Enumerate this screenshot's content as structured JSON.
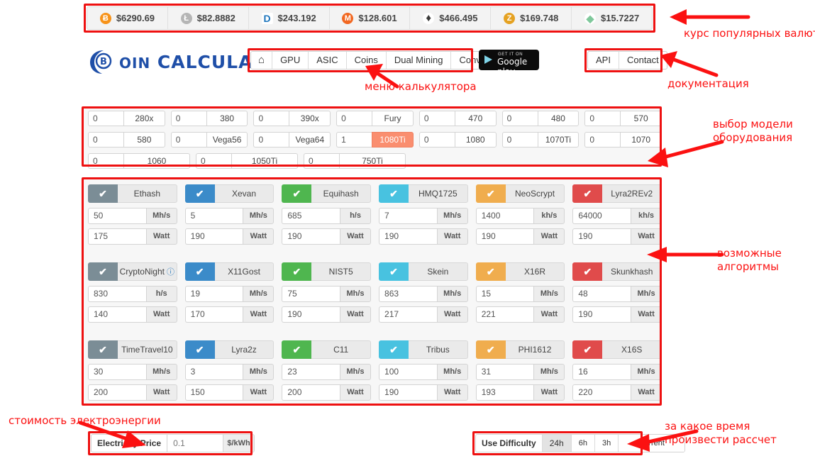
{
  "ticker": {
    "items": [
      {
        "icon": "bitcoin-icon",
        "symbol": "Ƀ",
        "price": "$6290.69"
      },
      {
        "icon": "litecoin-icon",
        "symbol": "Ł",
        "price": "$82.8882"
      },
      {
        "icon": "dash-icon",
        "symbol": "D",
        "price": "$243.192"
      },
      {
        "icon": "monero-icon",
        "symbol": "M",
        "price": "$128.601"
      },
      {
        "icon": "ethereum-icon",
        "symbol": "♦",
        "price": "$466.495"
      },
      {
        "icon": "zcash-icon",
        "symbol": "Z",
        "price": "$169.748"
      },
      {
        "icon": "zencash-icon",
        "symbol": "◆",
        "price": "$15.7227"
      }
    ]
  },
  "header": {
    "logo_primary": "OIN",
    "logo_secondary": "CALCULATORS",
    "main_menu": [
      {
        "name": "home",
        "label": "⌂"
      },
      {
        "name": "gpu",
        "label": "GPU"
      },
      {
        "name": "asic",
        "label": "ASIC"
      },
      {
        "name": "coins",
        "label": "Coins"
      },
      {
        "name": "dual-mining",
        "label": "Dual Mining"
      },
      {
        "name": "converter",
        "label": "Converter"
      }
    ],
    "google_play": {
      "line1": "GET IT ON",
      "line2": "Google play"
    },
    "doc_menu": [
      {
        "name": "api",
        "label": "API"
      },
      {
        "name": "contact",
        "label": "Contact"
      }
    ]
  },
  "gpu_grid": {
    "rows": [
      [
        {
          "qty": "0",
          "model": "280x",
          "selected": false
        },
        {
          "qty": "0",
          "model": "380",
          "selected": false
        },
        {
          "qty": "0",
          "model": "390x",
          "selected": false
        },
        {
          "qty": "0",
          "model": "Fury",
          "selected": false
        },
        {
          "qty": "0",
          "model": "470",
          "selected": false
        },
        {
          "qty": "0",
          "model": "480",
          "selected": false
        },
        {
          "qty": "0",
          "model": "570",
          "selected": false
        }
      ],
      [
        {
          "qty": "0",
          "model": "580",
          "selected": false
        },
        {
          "qty": "0",
          "model": "Vega56",
          "selected": false
        },
        {
          "qty": "0",
          "model": "Vega64",
          "selected": false
        },
        {
          "qty": "1",
          "model": "1080Ti",
          "selected": true
        },
        {
          "qty": "0",
          "model": "1080",
          "selected": false
        },
        {
          "qty": "0",
          "model": "1070Ti",
          "selected": false
        },
        {
          "qty": "0",
          "model": "1070",
          "selected": false
        }
      ],
      [
        {
          "qty": "0",
          "model": "1060",
          "selected": false
        },
        {
          "qty": "0",
          "model": "1050Ti",
          "selected": false
        },
        {
          "qty": "0",
          "model": "750Ti",
          "selected": false
        }
      ]
    ]
  },
  "algorithms": {
    "check_glyph": "✔",
    "help_glyph": "❓",
    "rows": [
      [
        {
          "name": "Ethash",
          "color_class": "c-gray",
          "color": "#7b8d96",
          "hashrate": "50",
          "hash_unit": "Mh/s",
          "power": "175",
          "power_unit": "Watt",
          "checked": true,
          "help": false
        },
        {
          "name": "Xevan",
          "color_class": "c-blue",
          "color": "#3b8bc9",
          "hashrate": "5",
          "hash_unit": "Mh/s",
          "power": "190",
          "power_unit": "Watt",
          "checked": true,
          "help": false
        },
        {
          "name": "Equihash",
          "color_class": "c-green",
          "color": "#4fb64f",
          "hashrate": "685",
          "hash_unit": "h/s",
          "power": "190",
          "power_unit": "Watt",
          "checked": true,
          "help": false
        },
        {
          "name": "HMQ1725",
          "color_class": "c-cyan",
          "color": "#48c2e0",
          "hashrate": "7",
          "hash_unit": "Mh/s",
          "power": "190",
          "power_unit": "Watt",
          "checked": true,
          "help": false
        },
        {
          "name": "NeoScrypt",
          "color_class": "c-orange",
          "color": "#f0ad4e",
          "hashrate": "1400",
          "hash_unit": "kh/s",
          "power": "190",
          "power_unit": "Watt",
          "checked": true,
          "help": false
        },
        {
          "name": "Lyra2REv2",
          "color_class": "c-red",
          "color": "#e04b4b",
          "hashrate": "64000",
          "hash_unit": "kh/s",
          "power": "190",
          "power_unit": "Watt",
          "checked": true,
          "help": false
        }
      ],
      [
        {
          "name": "CryptoNight",
          "color_class": "c-gray",
          "color": "#7b8d96",
          "hashrate": "830",
          "hash_unit": "h/s",
          "power": "140",
          "power_unit": "Watt",
          "checked": true,
          "help": true
        },
        {
          "name": "X11Gost",
          "color_class": "c-blue",
          "color": "#3b8bc9",
          "hashrate": "19",
          "hash_unit": "Mh/s",
          "power": "170",
          "power_unit": "Watt",
          "checked": true,
          "help": false
        },
        {
          "name": "NIST5",
          "color_class": "c-green",
          "color": "#4fb64f",
          "hashrate": "75",
          "hash_unit": "Mh/s",
          "power": "190",
          "power_unit": "Watt",
          "checked": true,
          "help": false
        },
        {
          "name": "Skein",
          "color_class": "c-cyan",
          "color": "#48c2e0",
          "hashrate": "863",
          "hash_unit": "Mh/s",
          "power": "217",
          "power_unit": "Watt",
          "checked": true,
          "help": false
        },
        {
          "name": "X16R",
          "color_class": "c-orange",
          "color": "#f0ad4e",
          "hashrate": "15",
          "hash_unit": "Mh/s",
          "power": "221",
          "power_unit": "Watt",
          "checked": true,
          "help": false
        },
        {
          "name": "Skunkhash",
          "color_class": "c-red",
          "color": "#e04b4b",
          "hashrate": "48",
          "hash_unit": "Mh/s",
          "power": "190",
          "power_unit": "Watt",
          "checked": true,
          "help": false
        }
      ],
      [
        {
          "name": "TimeTravel10",
          "color_class": "c-gray",
          "color": "#7b8d96",
          "hashrate": "30",
          "hash_unit": "Mh/s",
          "power": "200",
          "power_unit": "Watt",
          "checked": true,
          "help": false
        },
        {
          "name": "Lyra2z",
          "color_class": "c-blue",
          "color": "#3b8bc9",
          "hashrate": "3",
          "hash_unit": "Mh/s",
          "power": "150",
          "power_unit": "Watt",
          "checked": true,
          "help": false
        },
        {
          "name": "C11",
          "color_class": "c-green",
          "color": "#4fb64f",
          "hashrate": "23",
          "hash_unit": "Mh/s",
          "power": "200",
          "power_unit": "Watt",
          "checked": true,
          "help": false
        },
        {
          "name": "Tribus",
          "color_class": "c-cyan",
          "color": "#48c2e0",
          "hashrate": "100",
          "hash_unit": "Mh/s",
          "power": "190",
          "power_unit": "Watt",
          "checked": true,
          "help": false
        },
        {
          "name": "PHI1612",
          "color_class": "c-orange",
          "color": "#f0ad4e",
          "hashrate": "31",
          "hash_unit": "Mh/s",
          "power": "193",
          "power_unit": "Watt",
          "checked": true,
          "help": false
        },
        {
          "name": "X16S",
          "color_class": "c-red",
          "color": "#e04b4b",
          "hashrate": "16",
          "hash_unit": "Mh/s",
          "power": "220",
          "power_unit": "Watt",
          "checked": true,
          "help": false
        }
      ]
    ]
  },
  "electricity": {
    "label": "Electricity Price",
    "value": "0.1",
    "unit": "$/kWh"
  },
  "difficulty": {
    "label": "Use Difficulty",
    "options": [
      {
        "label": "24h",
        "active": true
      },
      {
        "label": "6h",
        "active": false
      },
      {
        "label": "3h",
        "active": false
      },
      {
        "label": "Current",
        "active": false
      }
    ]
  },
  "annotations": {
    "color": "#fb1111",
    "items": [
      {
        "name": "annotation-rates",
        "text": "курс популярных валют"
      },
      {
        "name": "annotation-menu",
        "text": "меню калькулятора"
      },
      {
        "name": "annotation-docs",
        "text": "документация"
      },
      {
        "name": "annotation-hardware",
        "text": "выбор модели\nоборудования"
      },
      {
        "name": "annotation-algorithms",
        "text": "возможные\nалгоритмы"
      },
      {
        "name": "annotation-electricity",
        "text": "стоимость электроэнергии"
      },
      {
        "name": "annotation-period",
        "text": "за какое время\nпроизвести рассчет"
      }
    ]
  }
}
